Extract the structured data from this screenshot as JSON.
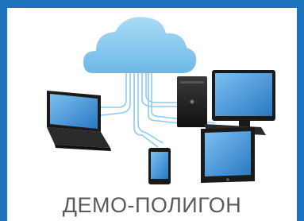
{
  "caption": "ДЕМО-ПОЛИГОН",
  "colors": {
    "frame": "#1e73be",
    "cloud": "#8ccbf0",
    "cable": "#8ccbf0",
    "screen": "#3d8fd1",
    "device_body": "#1c1c1c",
    "caption_text": "#5a5a5a"
  },
  "icons": [
    "cloud-icon",
    "laptop-icon",
    "tower-pc-icon",
    "monitor-icon",
    "smartphone-icon",
    "tablet-icon",
    "keyboard-icon"
  ]
}
